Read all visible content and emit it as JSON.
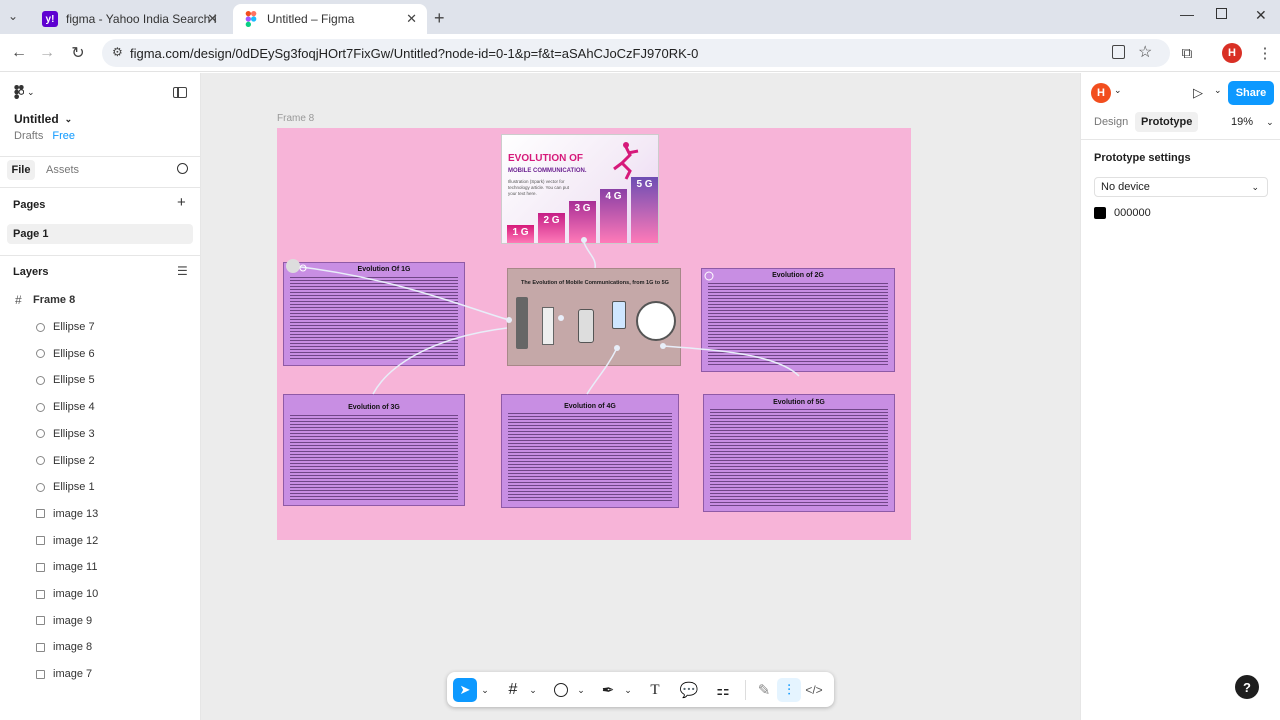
{
  "browser": {
    "tabs": [
      {
        "title": "figma - Yahoo India Search Res",
        "icon": "yahoo-icon"
      },
      {
        "title": "Untitled – Figma",
        "icon": "figma-icon"
      }
    ],
    "url": "figma.com/design/0dDEySg3foqjHOrt7FixGw/Untitled?node-id=0-1&p=f&t=aSAhCJoCzFJ970RK-0",
    "profile_initial": "H"
  },
  "file": {
    "name": "Untitled",
    "location": "Drafts",
    "plan": "Free"
  },
  "left_tabs": [
    "File",
    "Assets"
  ],
  "pages": {
    "heading": "Pages",
    "items": [
      "Page 1"
    ]
  },
  "layers": {
    "heading": "Layers",
    "frame": "Frame 8",
    "items": [
      {
        "name": "Ellipse 7",
        "type": "ellipse"
      },
      {
        "name": "Ellipse 6",
        "type": "ellipse"
      },
      {
        "name": "Ellipse 5",
        "type": "ellipse"
      },
      {
        "name": "Ellipse 4",
        "type": "ellipse"
      },
      {
        "name": "Ellipse 3",
        "type": "ellipse"
      },
      {
        "name": "Ellipse 2",
        "type": "ellipse"
      },
      {
        "name": "Ellipse 1",
        "type": "ellipse"
      },
      {
        "name": "image 13",
        "type": "image"
      },
      {
        "name": "image 12",
        "type": "image"
      },
      {
        "name": "image 11",
        "type": "image"
      },
      {
        "name": "image 10",
        "type": "image"
      },
      {
        "name": "image 9",
        "type": "image"
      },
      {
        "name": "image 8",
        "type": "image"
      },
      {
        "name": "image 7",
        "type": "image"
      }
    ]
  },
  "canvas": {
    "frame_label": "Frame 8",
    "hero": {
      "title_line1": "EVOLUTION OF",
      "title_line2": "MOBILE COMMUNICATION.",
      "subtitle": "Illustration (Spark) vector for technology article. You can put your text here.",
      "bars": [
        "1 G",
        "2 G",
        "3 G",
        "4 G",
        "5 G"
      ]
    },
    "center_title": "The Evolution of Mobile Communications, from 1G to 5G",
    "cards": {
      "g1": "Evolution Of 1G",
      "g2": "Evolution of 2G",
      "g3": "Evolution of 3G",
      "g4": "Evolution of 4G",
      "g5": "Evolution of 5G"
    }
  },
  "right": {
    "avatar": "H",
    "share": "Share",
    "tabs": [
      "Design",
      "Prototype"
    ],
    "zoom": "19%",
    "settings_title": "Prototype settings",
    "device": "No device",
    "color": "000000"
  },
  "colors": {
    "accent": "#0d99ff",
    "frame_bg": "#f7b4d8",
    "card_bg": "#c88ee3",
    "avatar": "#f24e1e"
  }
}
